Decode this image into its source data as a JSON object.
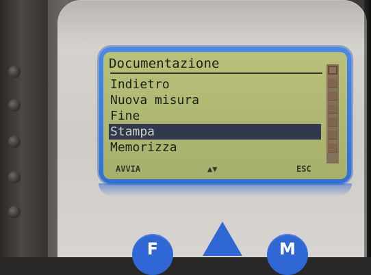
{
  "screen": {
    "title": "Documentazione",
    "menu": [
      {
        "label": "Indietro"
      },
      {
        "label": "Nuova misura"
      },
      {
        "label": "Fine"
      },
      {
        "label": "Stampa"
      },
      {
        "label": "Memorizza"
      }
    ],
    "selected_item": "Stampa",
    "softkeys": {
      "left": "AVVIA",
      "middle": "▲▼",
      "right": "ESC"
    }
  },
  "hardware_buttons": {
    "left_letter": "F",
    "right_letter": "M"
  },
  "colors": {
    "lcd_background": "#b3ba76",
    "bezel_blue": "#3b7be3",
    "selection": "#30394e",
    "device_body": "#d1cec9",
    "button_blue": "#2f67d5"
  }
}
